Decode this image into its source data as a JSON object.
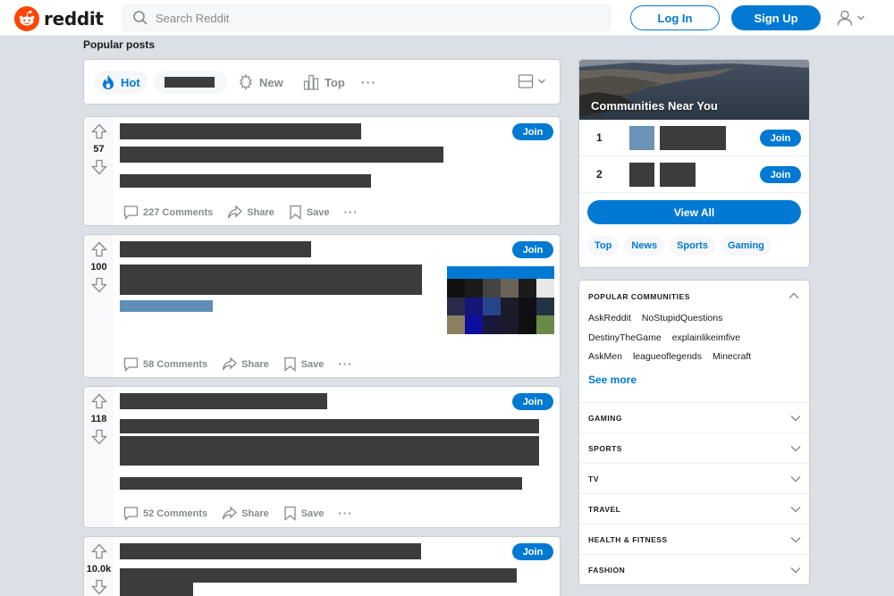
{
  "brand": {
    "name": "reddit",
    "accent": "#ff4500"
  },
  "search": {
    "placeholder": "Search Reddit"
  },
  "header": {
    "login_label": "Log In",
    "signup_label": "Sign Up"
  },
  "page_title": "Popular posts",
  "sort": {
    "hot": "Hot",
    "new": "New",
    "top": "Top",
    "more": "···"
  },
  "posts": [
    {
      "votes": "57",
      "join": "Join",
      "comments": "227 Comments",
      "share": "Share",
      "save": "Save",
      "more": "···"
    },
    {
      "votes": "100",
      "join": "Join",
      "comments": "58 Comments",
      "share": "Share",
      "save": "Save",
      "more": "···"
    },
    {
      "votes": "118",
      "join": "Join",
      "comments": "52 Comments",
      "share": "Share",
      "save": "Save",
      "more": "···"
    },
    {
      "votes": "10.0k",
      "join": "Join"
    }
  ],
  "communities_near": {
    "title": "Communities Near You",
    "items": [
      {
        "rank": "1",
        "join": "Join"
      },
      {
        "rank": "2",
        "join": "Join"
      }
    ],
    "view_all": "View All",
    "chips": [
      "Top",
      "News",
      "Sports",
      "Gaming"
    ]
  },
  "popular": {
    "title": "POPULAR COMMUNITIES",
    "rows": [
      [
        "AskReddit",
        "NoStupidQuestions"
      ],
      [
        "DestinyTheGame",
        "explainlikeimfive"
      ],
      [
        "AskMen",
        "leagueoflegends",
        "Minecraft"
      ]
    ],
    "see_more": "See more",
    "categories": [
      "GAMING",
      "SPORTS",
      "TV",
      "TRAVEL",
      "HEALTH & FITNESS",
      "FASHION"
    ]
  }
}
